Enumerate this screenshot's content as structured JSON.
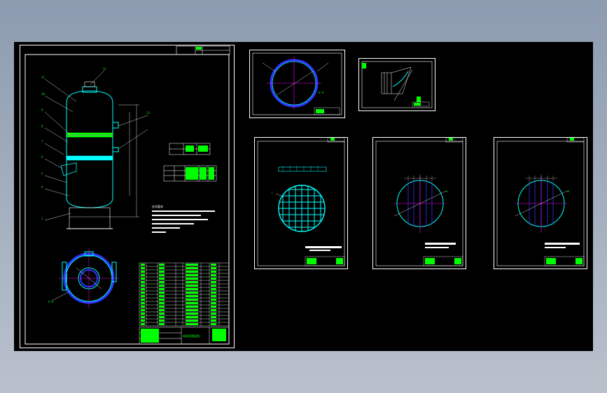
{
  "main_sheet": {
    "title_block_text": "吸收塔装配图",
    "view_label": "A-A",
    "part_numbers": [
      "1",
      "2",
      "3",
      "4",
      "5",
      "6",
      "7",
      "8",
      "9",
      "10",
      "11",
      "12",
      "13",
      "14",
      "15"
    ],
    "notes_heading": "技术要求"
  },
  "top_sheet_1": {
    "view_label": "A-A"
  },
  "top_sheet_2": {
    "view_label": "B"
  },
  "detail_sheets": [
    {
      "view_label": "Ⅰ"
    },
    {
      "view_label": "Ⅱ"
    },
    {
      "view_label": "Ⅲ"
    }
  ],
  "colors": {
    "background": "#000000",
    "frame": "#ffffff",
    "vessel": "#00ffff",
    "text": "#00ff00",
    "center_line": "#ff00ff",
    "hatch": "#3333ff"
  }
}
